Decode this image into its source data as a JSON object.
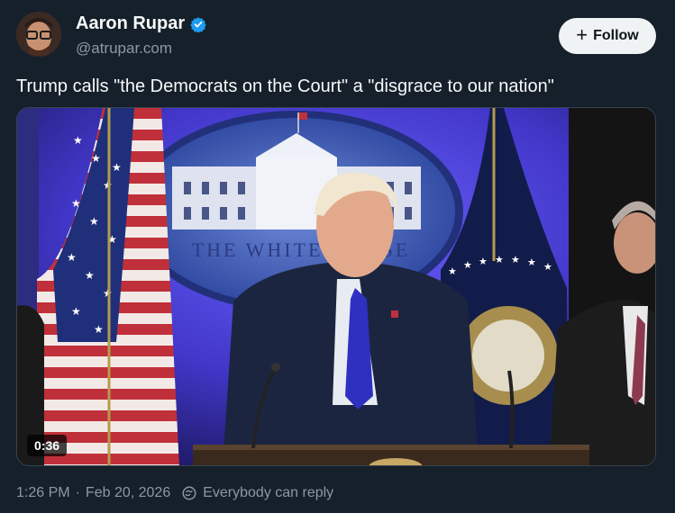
{
  "author": {
    "display_name": "Aaron Rupar",
    "handle": "@atrupar.com",
    "verified": true
  },
  "follow_button": {
    "label": "Follow"
  },
  "tweet": {
    "text": "Trump calls \"the Democrats on the Court\" a \"disgrace to our nation\""
  },
  "media": {
    "type": "video",
    "duration": "0:36",
    "backdrop_text": "THE WHITE HOUSE"
  },
  "meta": {
    "time": "1:26 PM",
    "date": "Feb 20, 2026",
    "reply_setting": "Everybody can reply"
  },
  "colors": {
    "background": "#15202b",
    "verified": "#1d9bf0",
    "secondary_text": "#8b98a5"
  }
}
